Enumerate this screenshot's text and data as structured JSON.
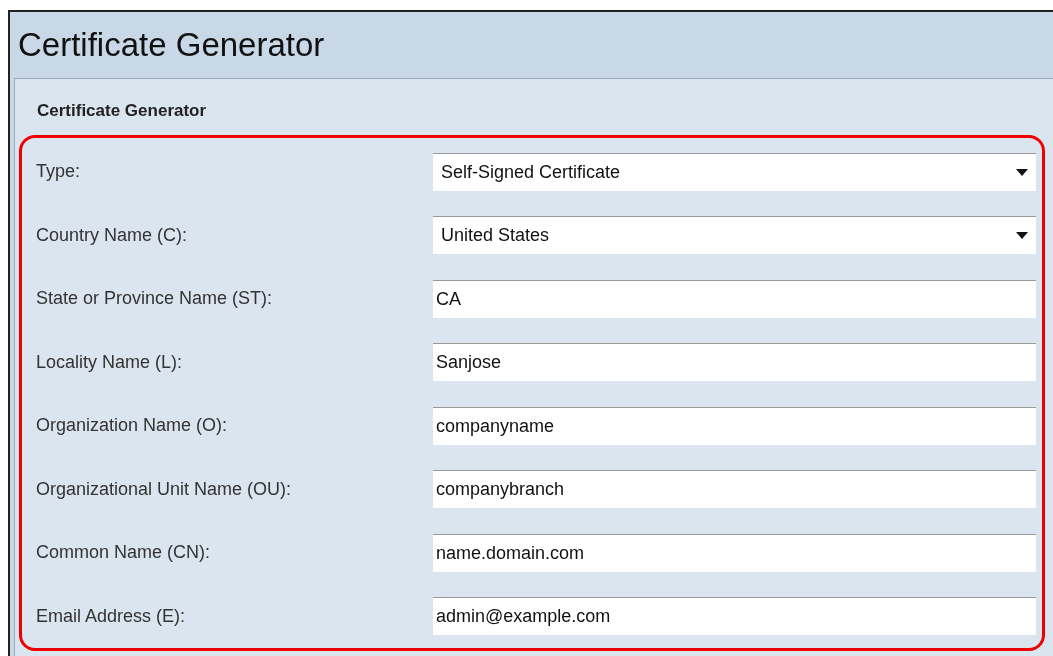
{
  "window": {
    "title": "Certificate Generator"
  },
  "section": {
    "title": "Certificate Generator"
  },
  "fields": [
    {
      "label": "Type:",
      "kind": "select",
      "value": "Self-Signed Certificate"
    },
    {
      "label": "Country Name (C):",
      "kind": "select",
      "value": "United States"
    },
    {
      "label": "State or Province Name (ST):",
      "kind": "text",
      "value": "CA"
    },
    {
      "label": "Locality Name (L):",
      "kind": "text",
      "value": "Sanjose"
    },
    {
      "label": "Organization Name (O):",
      "kind": "text",
      "value": "companyname"
    },
    {
      "label": "Organizational Unit Name (OU):",
      "kind": "text",
      "value": "companybranch"
    },
    {
      "label": "Common Name (CN):",
      "kind": "text",
      "value": "name.domain.com"
    },
    {
      "label": "Email Address (E):",
      "kind": "text",
      "value": "admin@example.com"
    }
  ]
}
